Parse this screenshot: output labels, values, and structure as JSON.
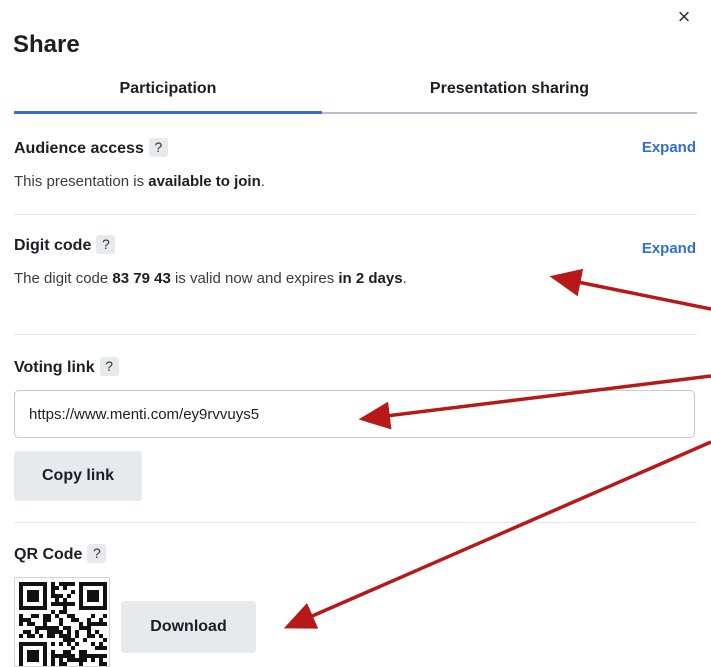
{
  "dialog": {
    "close_glyph": "×",
    "title": "Share"
  },
  "tabs": [
    {
      "label": "Participation",
      "active": true
    },
    {
      "label": "Presentation sharing",
      "active": false
    }
  ],
  "help_glyph": "?",
  "audience_access": {
    "heading": "Audience access",
    "expand": "Expand",
    "desc_prefix": "This presentation is ",
    "desc_bold": "available to join",
    "desc_suffix": "."
  },
  "digit_code": {
    "heading": "Digit code",
    "expand": "Expand",
    "desc_prefix": "The digit code ",
    "code": "83 79 43",
    "desc_middle": " is valid now and expires ",
    "expires": "in 2 days",
    "desc_suffix": "."
  },
  "voting_link": {
    "heading": "Voting link",
    "url": "https://www.menti.com/ey9rvvuys5",
    "copy_label": "Copy link"
  },
  "qr_code": {
    "heading": "QR Code",
    "qr_icon": "qr-code-icon",
    "download_label": "Download"
  },
  "colors": {
    "accent": "#2f6fd6",
    "annotation_arrow": "#b71818",
    "chip_bg": "#e8e9ec"
  }
}
